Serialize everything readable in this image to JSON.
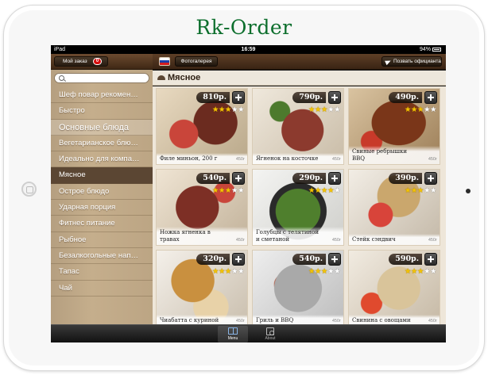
{
  "app": {
    "logo_text": "Rk-Order"
  },
  "statusbar": {
    "carrier": "iPad",
    "time": "16:59",
    "battery": "94%"
  },
  "sidebar": {
    "order_button": "Мой заказ",
    "order_count": "0",
    "search_placeholder": "",
    "items": [
      {
        "label": "Шеф повар рекомен…",
        "state": "normal"
      },
      {
        "label": "Быстро",
        "state": "normal"
      },
      {
        "label": "Основные блюда",
        "state": "highlight"
      },
      {
        "label": "Вегетарианское блю…",
        "state": "normal"
      },
      {
        "label": "Идеально для компа…",
        "state": "normal"
      },
      {
        "label": "Мясное",
        "state": "active"
      },
      {
        "label": "Острое блюдо",
        "state": "normal"
      },
      {
        "label": "Ударная порция",
        "state": "normal"
      },
      {
        "label": "Фитнес питание",
        "state": "normal"
      },
      {
        "label": "Рыбное",
        "state": "normal"
      },
      {
        "label": "Безалкогольные нап…",
        "state": "normal"
      },
      {
        "label": "Тапас",
        "state": "normal"
      },
      {
        "label": "Чай",
        "state": "normal"
      }
    ]
  },
  "topbar": {
    "gallery_button": "Фотогалерея",
    "waiter_button": "Позвать официанта"
  },
  "section": {
    "title": "Мясное"
  },
  "dishes": [
    {
      "name": "Филе миньон, 200 г",
      "price": "810р.",
      "rating": 3,
      "weight": "450г"
    },
    {
      "name": "Ягненок на косточке",
      "price": "790р.",
      "rating": 3,
      "weight": "450г"
    },
    {
      "name": "Свиные ребрышки BBQ",
      "price": "490р.",
      "rating": 3,
      "weight": "450г"
    },
    {
      "name": "Ножка ягненка в травах",
      "price": "540р.",
      "rating": 3,
      "weight": "450г"
    },
    {
      "name": "Голубцы с телятиной и сметаной",
      "price": "290р.",
      "rating": 4,
      "weight": "450г"
    },
    {
      "name": "Стейк сэндвич",
      "price": "390р.",
      "rating": 3,
      "weight": "450г"
    },
    {
      "name": "Чиабатта с куриной",
      "price": "320р.",
      "rating": 3,
      "weight": "450г"
    },
    {
      "name": "Гриль и BBQ",
      "price": "540р.",
      "rating": 3,
      "weight": "450г"
    },
    {
      "name": "Свинина с овощами",
      "price": "590р.",
      "rating": 3,
      "weight": "450г"
    }
  ],
  "tabbar": [
    {
      "label": "Menu",
      "icon": "book-icon",
      "active": true
    },
    {
      "label": "About",
      "icon": "about-icon",
      "active": false
    }
  ],
  "colors": {
    "brand_green": "#0c6e2c",
    "wood_dark": "#3a2414",
    "sidebar_bg": "#c5ae8c",
    "active_item": "#5b4633",
    "star_on": "#f5c400"
  }
}
